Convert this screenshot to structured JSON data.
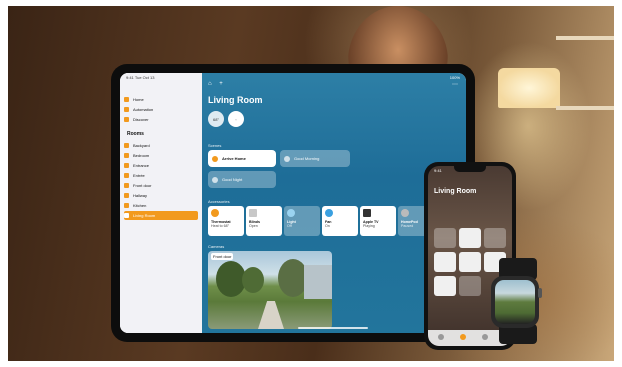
{
  "ipad": {
    "status_time": "9:41 Tue Oct 13",
    "status_right": "100%",
    "sidebar": {
      "items": [
        {
          "label": "Home",
          "icon": "house-icon"
        },
        {
          "label": "Automation",
          "icon": "clock-icon"
        },
        {
          "label": "Discover",
          "icon": "star-icon"
        }
      ],
      "rooms_header": "Rooms",
      "rooms": [
        {
          "label": "Backyard",
          "icon": "room-icon"
        },
        {
          "label": "Bedroom",
          "icon": "room-icon"
        },
        {
          "label": "Entrance",
          "icon": "room-icon"
        },
        {
          "label": "Entrée",
          "icon": "room-icon"
        },
        {
          "label": "Front door",
          "icon": "room-icon"
        },
        {
          "label": "Hallway",
          "icon": "room-icon"
        },
        {
          "label": "Kitchen",
          "icon": "room-icon"
        },
        {
          "label": "Living Room",
          "icon": "room-icon",
          "active": true
        }
      ]
    },
    "main": {
      "title": "Living Room",
      "status": [
        {
          "label": "68°"
        },
        {
          "label": "◦"
        }
      ],
      "scenes_label": "Scenes",
      "scenes": [
        {
          "label": "Arrive Home",
          "on": true
        },
        {
          "label": "Good Morning",
          "on": false
        },
        {
          "label": "Good Night",
          "on": false
        }
      ],
      "accessories_label": "Accessories",
      "accessories": [
        {
          "name": "Thermostat",
          "state": "Heat to 68°",
          "on": true,
          "color": "#f29a1e"
        },
        {
          "name": "Blinds",
          "state": "Open",
          "on": true,
          "color": "#c8c8c8"
        },
        {
          "name": "Light",
          "state": "Off",
          "on": false,
          "color": "#9ad3f0"
        },
        {
          "name": "Fan",
          "state": "On",
          "on": true,
          "color": "#3aa0e0"
        },
        {
          "name": "Apple TV",
          "state": "Playing",
          "on": true,
          "color": "#333333"
        },
        {
          "name": "HomePod",
          "state": "Paused",
          "on": false,
          "color": "#bbbbbb"
        }
      ],
      "cameras_label": "Cameras",
      "camera": {
        "label": "Front door"
      }
    }
  },
  "iphone": {
    "time": "9:41",
    "title": "Living Room"
  },
  "colors": {
    "accent": "#f29a1e",
    "sidebar_bg": "#f2f2f6",
    "main_bg": "#1e6d98"
  }
}
